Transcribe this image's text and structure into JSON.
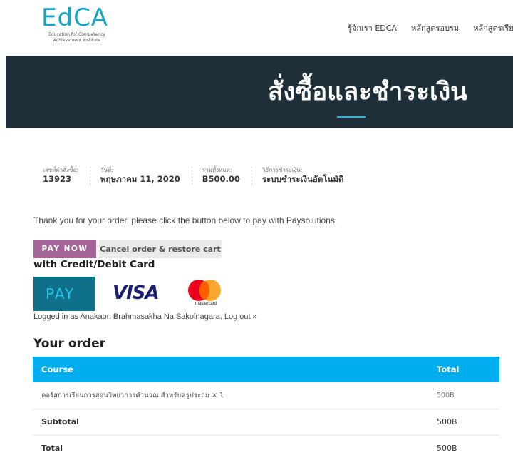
{
  "header": {
    "logo_text": "EdCA",
    "logo_subtitle": "Education for Competency Achievement Institute",
    "nav": [
      "รู้จักเรา EDCA",
      "หลักสูตรอบรม",
      "หลักสูตรเรีย"
    ]
  },
  "hero": {
    "title": "สั่งซื้อและชำระเงิน"
  },
  "order_details": [
    {
      "label": "เลขที่คำสั่งซื้อ:",
      "value": "13923"
    },
    {
      "label": "วันที่:",
      "value": "พฤษภาคม 11, 2020"
    },
    {
      "label": "รวมทั้งหมด:",
      "value": "B500.00"
    },
    {
      "label": "วิธีการชำระเงิน:",
      "value": "ระบบชำระเงินอัตโนมัติ"
    }
  ],
  "thank_you": "Thank you for your order, please click the button below to pay with Paysolutions.",
  "buttons": {
    "pay_now": "PAY NOW",
    "cancel": "Cancel order & restore cart"
  },
  "with_card": "with Credit/Debit Card",
  "cards": {
    "pay": "PAY",
    "visa": "VISA",
    "mastercard": "mastercard"
  },
  "logged_in": {
    "text": "Logged in as Anakaon Brahmasakha Na Sakolnagara.",
    "logout": "Log out »"
  },
  "your_order": "Your order",
  "table": {
    "headers": {
      "course": "Course",
      "total": "Total"
    },
    "item": {
      "name": "คอร์สการเรียนการสอนวิทยาการคำนวณ สำหรับครูประถม × 1",
      "total": "500B"
    },
    "subtotal": {
      "label": "Subtotal",
      "value": "500B"
    },
    "total": {
      "label": "Total",
      "value": "500B"
    }
  },
  "colors": {
    "accent": "#00adef",
    "pay_button": "#a46497",
    "hero_bg": "#1f2f3a"
  }
}
